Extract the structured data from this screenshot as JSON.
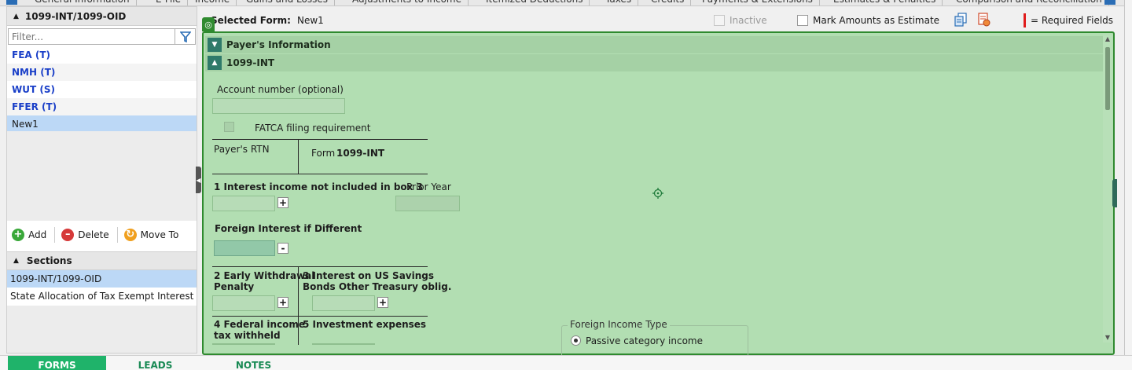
{
  "top_tabs": [
    "General Information",
    "E-File",
    "Income",
    "Gains and Losses",
    "Adjustments to Income",
    "Itemized Deductions",
    "Taxes",
    "Credits",
    "Payments & Extensions",
    "Estimates & Penalties",
    "Comparison and Reconciliation"
  ],
  "left_panel": {
    "title": "1099-INT/1099-OID",
    "filter_placeholder": "Filter...",
    "forms": [
      {
        "label": "FEA (T)"
      },
      {
        "label": "NMH (T)"
      },
      {
        "label": "WUT (S)"
      },
      {
        "label": "FFER (T)"
      },
      {
        "label": "New1"
      }
    ],
    "selected_form_index": 4,
    "actions": {
      "add": "Add",
      "delete": "Delete",
      "move_to": "Move To"
    },
    "sections_title": "Sections",
    "sections": [
      {
        "label": "1099-INT/1099-OID"
      },
      {
        "label": "State Allocation of Tax Exempt Interest"
      }
    ]
  },
  "toolbar": {
    "selected_form_label": "Selected Form:",
    "selected_form_value": "New1",
    "inactive_label": "Inactive",
    "estimate_label": "Mark Amounts as Estimate",
    "required_label": "= Required Fields"
  },
  "form": {
    "payer_section": "Payer's Information",
    "int_section": "1099-INT",
    "account_number_label": "Account number (optional)",
    "fatca_label": "FATCA filing requirement",
    "payers_rtn_label": "Payer's RTN",
    "form_prefix": "Form",
    "form_name": "1099-INT",
    "box1_label": "1 Interest income not included in box 3",
    "prior_year_label": "Prior Year",
    "foreign_interest_label": "Foreign Interest if Different",
    "box2_label_line1": "2 Early Withdrawal",
    "box2_label_line2": "Penalty",
    "box3_label_line1": "3 Interest on US Savings",
    "box3_label_line2": "Bonds Other Treasury oblig.",
    "box4_label_line1": "4 Federal income",
    "box4_label_line2": "tax withheld",
    "box5_label": "5 Investment expenses",
    "foreign_income_type_label": "Foreign Income Type",
    "passive_label": "Passive category income"
  },
  "bottom_tabs": [
    "FORMS",
    "LEADS",
    "NOTES"
  ],
  "colors": {
    "accent_green": "#2f8a2f",
    "form_bg": "#b2deb2",
    "link_blue": "#1a3fc8",
    "required_red": "#e01b1b",
    "tab_active": "#1fb36a"
  }
}
